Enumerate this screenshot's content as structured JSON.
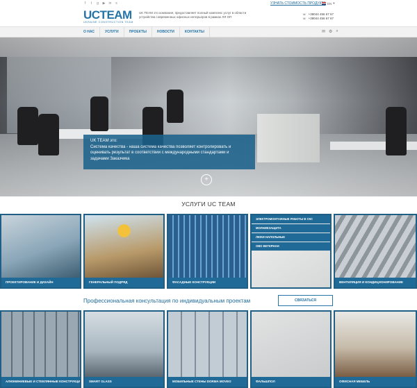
{
  "topbar": {
    "social_icons": [
      "facebook-icon",
      "twitter-icon",
      "google-plus-icon",
      "youtube-icon",
      "linkedin-icon",
      "skype-icon"
    ],
    "social_glyphs": [
      "f",
      "t",
      "g",
      "▶",
      "in",
      "s"
    ],
    "price_link": "УЗНАТЬ СТОИМОСТЬ ПРОДУКТА",
    "language": "EN"
  },
  "header": {
    "logo_main": "UCTEAM",
    "logo_sub": "UKRAINE CONSTRUCTION TEAM",
    "description": "UK TEAM это компания, предоставляет полный комплекс услуг в области устройства современных офисных интерьеров в рамках ЛЛ ОП",
    "phone_1": "+38044 456 67 67",
    "phone_2": "+38044 456 67 67"
  },
  "nav": {
    "items": [
      "О НАС",
      "УСЛУГИ",
      "ПРОЕКТЫ",
      "НОВОСТИ",
      "КОНТАКТЫ"
    ]
  },
  "hero": {
    "caption_title": "UK TEAM это:",
    "caption_text": "Система качества - наша система качества позволяет контролировать и оценивать результат в соответствии с международными стандартами и задачами Заказчика",
    "plus": "+"
  },
  "services": {
    "title": "УСЛУГИ UC TEAM",
    "row1": [
      {
        "label": "ПРОЕКТИРОВАНИЕ И ДИЗАЙН",
        "color": "#8aa6b8"
      },
      {
        "label": "ГЕНЕРАЛЬНЫЙ ПОДРЯД",
        "color": "#b89a6a"
      },
      {
        "label": "ФАСАДНЫЕ КОНСТРУКЦИИ",
        "color": "#4f88b8"
      },
      {
        "label": "",
        "color": "#e4e6e6"
      },
      {
        "label": "ВЕНТИЛЯЦИЯ И КОНДИЦИОНИРОВАНИЕ",
        "color": "#9aa4ac"
      }
    ],
    "electrical_list": [
      "ЭЛЕКТРОМОНТАЖНЫЕ РАБОТЫ В СКС",
      "МОЛНИЕЗАЩИТА",
      "ЛЮКИ НАПОЛЬНЫЕ",
      "ОВО ВЕТЕРНАН"
    ],
    "row2": [
      {
        "label": "АЛЮМИНИЕВЫЕ И СТЕКЛЯННЫЕ КОНСТРУКЦИИ",
        "color": "#8c9aa6"
      },
      {
        "label": "SMART GLASS",
        "color": "#a8b6c0"
      },
      {
        "label": "МОБИЛЬНЫЕ СТЕНЫ DORMA MOVEO",
        "color": "#b0bcc6"
      },
      {
        "label": "ФАЛЬШПОЛ",
        "color": "#c9cbcc"
      },
      {
        "label": "ОФИСНАЯ МЕБЕЛЬ",
        "color": "#a99680"
      }
    ]
  },
  "consult": {
    "text": "Профессиональная консультация по индивидуальным проектам",
    "button": "СВЯЗАТЬСЯ"
  }
}
